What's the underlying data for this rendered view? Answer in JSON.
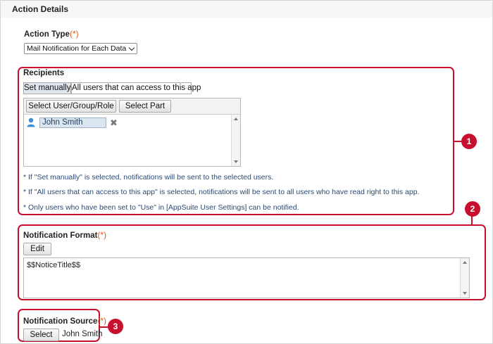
{
  "header": {
    "title": "Action Details"
  },
  "action_type": {
    "label": "Action Type",
    "required_mark": "(*)",
    "selected": "Mail Notification for Each Data"
  },
  "recipients": {
    "label": "Recipients",
    "tabs": [
      "Set manually",
      "All users that can access to this app"
    ],
    "active_tab": "Set manually",
    "buttons": {
      "select_user": "Select User/Group/Role",
      "select_part": "Select Part"
    },
    "selected_users": [
      "John Smith"
    ],
    "notes": [
      "* If \"Set manually\" is selected, notifications will be sent to the selected users.",
      "* If \"All users that can access to this app\" is selected, notifications will be sent to all users who have read right to this app.",
      "* Only users who have been set to \"Use\" in [AppSuite User Settings] can be notified."
    ]
  },
  "notification_format": {
    "label": "Notification Format",
    "required_mark": "(*)",
    "edit_label": "Edit",
    "value": "$$NoticeTitle$$"
  },
  "notification_source": {
    "label": "Notification Source",
    "required_mark": "(*)",
    "select_label": "Select",
    "value": "John Smith"
  },
  "callouts": [
    "1",
    "2",
    "3"
  ],
  "colors": {
    "callout": "#c8102e",
    "required": "#e05a1e",
    "note_text": "#2b4a73"
  },
  "icons": [
    "user-icon",
    "remove-icon",
    "chevron-down-icon",
    "scroll-up-icon",
    "scroll-down-icon"
  ]
}
